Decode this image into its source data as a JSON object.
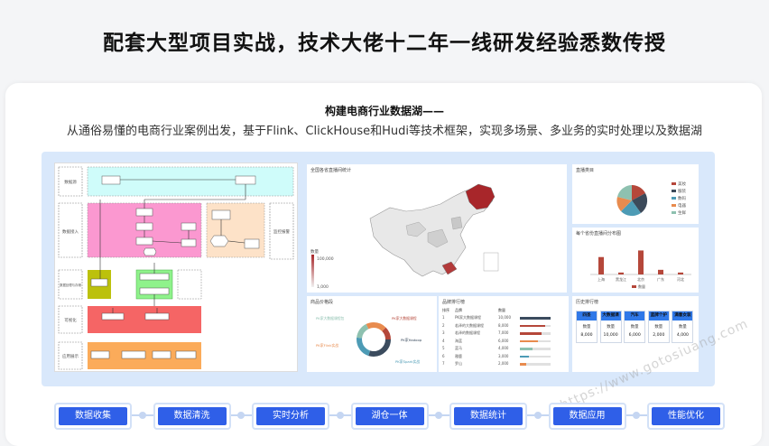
{
  "headline": "配套大型项目实战，技术大佬十二年一线研发经验悉数传授",
  "card": {
    "title": "构建电商行业数据湖——",
    "subtitle": "从通俗易懂的电商行业案例出发，基于Flink、ClickHouse和Hudi等技术框架，实现多场景、多业务的实时处理以及数据湖"
  },
  "architecture": {
    "row_labels": [
      "数据源",
      "数据接入",
      "数据处理与存储",
      "可视化",
      "应用展示"
    ],
    "side_label": "监控报警"
  },
  "dashboard": {
    "map": {
      "title": "全国各省直播间统计",
      "legend_title": "数量",
      "legend_max": "100,000",
      "legend_min": "1,000"
    },
    "pie": {
      "title": "直播类目",
      "legend": [
        "美妆",
        "服装",
        "数码",
        "电器",
        "生鲜"
      ]
    },
    "bar": {
      "title": "每个省份直播间分布图",
      "legend": "数量",
      "categories": [
        "上海",
        "黑龙江",
        "北京",
        "广东",
        "河北"
      ]
    },
    "donut": {
      "title": "商品价格段",
      "labels": [
        "PK家大数据课程包",
        "PK家大数据课程",
        "PK家Hadoop",
        "PK家Flink实战",
        "PK家Spark实战"
      ]
    },
    "ranking": {
      "title": "品牌排行榜",
      "headers": [
        "排序",
        "品牌",
        "数量"
      ],
      "rows": [
        [
          "1",
          "PK家大数据课程",
          "10,000"
        ],
        [
          "2",
          "若泽的大数据课程",
          "8,000"
        ],
        [
          "3",
          "若泽的数据课程",
          "7,000"
        ],
        [
          "4",
          "海蓝",
          "6,000"
        ],
        [
          "5",
          "蓝马",
          "4,000"
        ],
        [
          "6",
          "雅鹿",
          "3,000"
        ],
        [
          "7",
          "罗山",
          "2,000"
        ]
      ]
    },
    "history": {
      "title": "历史排行榜",
      "cards": [
        {
          "name": "四圣",
          "label": "数量",
          "value": "8,000"
        },
        {
          "name": "大数据课",
          "label": "数量",
          "value": "10,000"
        },
        {
          "name": "汽车",
          "label": "数量",
          "value": "6,000"
        },
        {
          "name": "蓝牌个护",
          "label": "数量",
          "value": "2,000"
        },
        {
          "name": "满意女装",
          "label": "数量",
          "value": "4,000"
        }
      ]
    }
  },
  "pipeline": [
    "数据收集",
    "数据清洗",
    "实时分析",
    "湖仓一体",
    "数据统计",
    "数据应用",
    "性能优化"
  ],
  "watermark": "https://www.gotosiuang.com",
  "chart_data": {
    "type": "bar",
    "categories": [
      "上海",
      "黑龙江",
      "北京",
      "广东",
      "河北"
    ],
    "series": [
      {
        "name": "数量",
        "values": [
          45,
          5,
          62,
          12,
          5
        ]
      }
    ],
    "ylim": [
      0,
      70
    ]
  },
  "colors": {
    "accent": "#2f5fe8",
    "map_high": "#a8262a",
    "bar": "#b5473a"
  }
}
